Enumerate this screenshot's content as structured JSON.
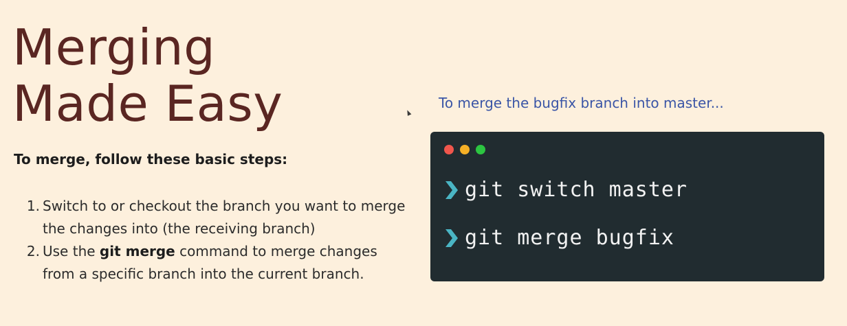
{
  "slide": {
    "title_lines": [
      "Merging",
      "Made Easy"
    ],
    "intro": "To merge, follow these basic steps:",
    "steps": [
      {
        "number": "1.",
        "text_parts": [
          "Switch to or checkout the branch you want to merge the changes into (the receiving branch)"
        ]
      },
      {
        "number": "2.",
        "text_before": "Use the ",
        "text_bold": "git merge",
        "text_after": " command to merge changes from a specific branch into the current branch."
      }
    ],
    "caption": "To merge the bugfix branch into master...",
    "terminal": {
      "window_buttons": [
        "close",
        "minimize",
        "maximize"
      ],
      "commands": [
        "git switch master",
        "git merge bugfix"
      ],
      "prompt_icon": "chevron-right-icon"
    }
  },
  "colors": {
    "background": "#fdf0dd",
    "title": "#5a2622",
    "caption": "#3a55a6",
    "terminal_bg": "#212c30",
    "prompt": "#4ab5c4",
    "dot_close": "#f0564c",
    "dot_minimize": "#f5b026",
    "dot_maximize": "#2cc541"
  }
}
